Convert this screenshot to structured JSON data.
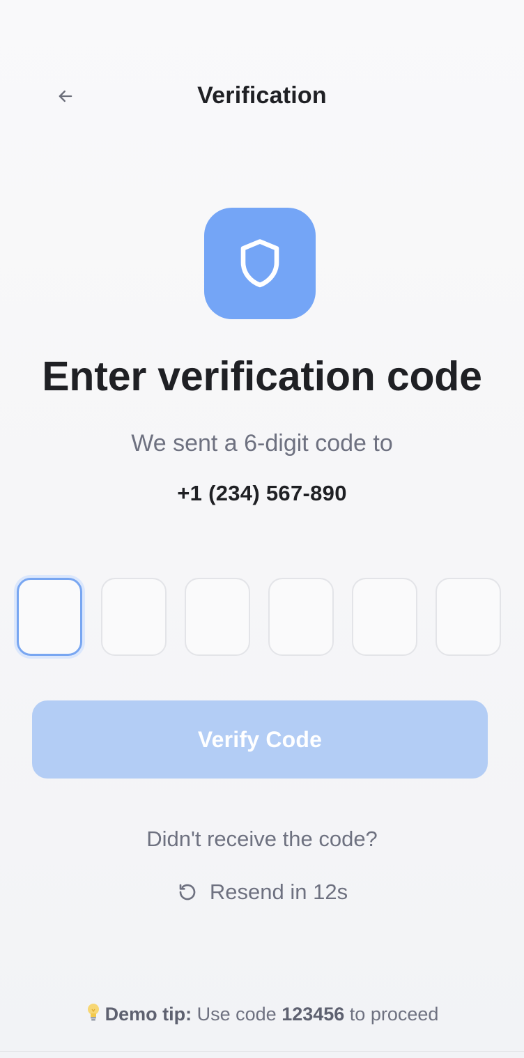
{
  "header": {
    "title": "Verification",
    "back_icon": "arrow-left-icon"
  },
  "hero": {
    "icon": "shield-icon",
    "icon_bg_color": "#74a5f6",
    "heading": "Enter verification code",
    "subtext": "We sent a 6-digit code to",
    "phone": "+1 (234) 567-890"
  },
  "otp": {
    "length": 6,
    "values": [
      "",
      "",
      "",
      "",
      "",
      ""
    ],
    "active_index": 0,
    "active_color": "#78a6f1"
  },
  "verify_button": {
    "label": "Verify Code",
    "disabled": true,
    "color": "#b3cdf5"
  },
  "resend": {
    "prompt": "Didn't receive the code?",
    "icon": "refresh-icon",
    "label": "Resend in 12s"
  },
  "demo_tip": {
    "icon": "lightbulb-icon",
    "label": "Demo tip:",
    "text_before": " Use code ",
    "code": "123456",
    "text_after": " to proceed"
  }
}
